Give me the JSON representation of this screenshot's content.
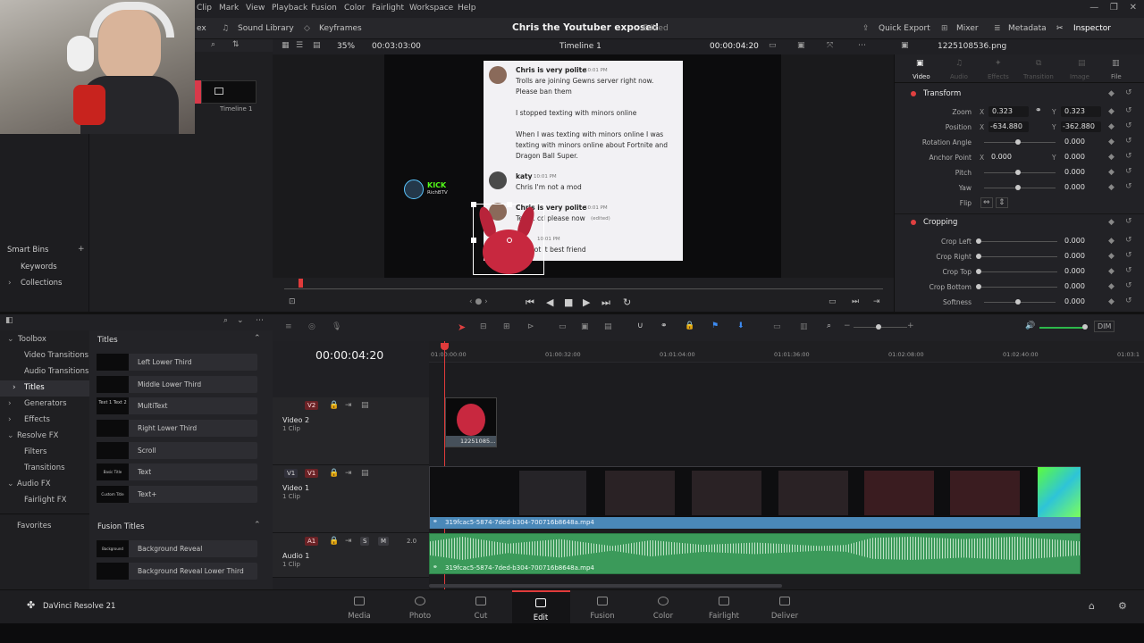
{
  "menubar": {
    "items": [
      "Clip",
      "Mark",
      "View",
      "Playback",
      "Fusion",
      "Color",
      "Fairlight",
      "Workspace",
      "Help"
    ]
  },
  "toolbar": {
    "index_partial": "ex",
    "sound_library": "Sound Library",
    "keyframes": "Keyframes",
    "project_title": "Chris the Youtuber exposed",
    "edited": "Edited",
    "quick_export": "Quick Export",
    "mixer": "Mixer",
    "metadata": "Metadata",
    "inspector": "Inspector"
  },
  "media": {
    "timeline_label": "Timeline 1",
    "smart_bins": "Smart Bins",
    "keywords": "Keywords",
    "collections": "Collections"
  },
  "viewer": {
    "zoom": "35%",
    "source_timecode": "00:03:03:00",
    "timeline_name": "Timeline 1",
    "record_timecode": "00:00:04:20",
    "clip_name": "1225108536.png"
  },
  "chat": {
    "msg1_name": "Chris is very polite",
    "msg1_time": "10:01 PM",
    "msg1_line1": "Trolls are joining Gewns server right now.",
    "msg1_line2": "Please ban them",
    "msg1_line3": "I stopped texting with minors online",
    "msg1_line4": "When I was texting with minors online I was",
    "msg1_line5": "texting with minors online about Fortnite and",
    "msg1_line6": "Dragon Ball Super.",
    "msg2_name": "katy",
    "msg2_time": "10:01 PM",
    "msg2_text": "Chris I'm not a mod",
    "msg3_name": "Chris is very polite",
    "msg3_time": "10:01 PM",
    "msg3_text": "Tell ... cd please now",
    "msg3_edited": "(edited)",
    "msg4_time": "10:01 PM",
    "msg4_text": "got it best friend",
    "kick_brand": "KICK",
    "kick_channel": "RichBTV"
  },
  "inspector": {
    "tabs": [
      "Video",
      "Audio",
      "Effects",
      "Transition",
      "Image",
      "File"
    ],
    "transform_title": "Transform",
    "zoom_label": "Zoom",
    "zoom_x": "0.323",
    "zoom_y": "0.323",
    "position_label": "Position",
    "position_x": "-634.880",
    "position_y": "-362.880",
    "rotation_label": "Rotation Angle",
    "rotation_val": "0.000",
    "anchor_label": "Anchor Point",
    "anchor_x": "0.000",
    "anchor_y": "0.000",
    "pitch_label": "Pitch",
    "pitch_val": "0.000",
    "yaw_label": "Yaw",
    "yaw_val": "0.000",
    "flip_label": "Flip",
    "cropping_title": "Cropping",
    "crop_left_label": "Crop Left",
    "crop_left": "0.000",
    "crop_right_label": "Crop Right",
    "crop_right": "0.000",
    "crop_top_label": "Crop Top",
    "crop_top": "0.000",
    "crop_bottom_label": "Crop Bottom",
    "crop_bottom": "0.000",
    "softness_label": "Softness",
    "softness": "0.000",
    "x": "X",
    "y": "Y"
  },
  "toolbox": {
    "items": [
      "Toolbox",
      "Video Transitions",
      "Audio Transitions",
      "Titles",
      "Generators",
      "Effects",
      "Resolve FX",
      "Filters",
      "Transitions",
      "Audio FX",
      "Fairlight FX",
      "Favorites"
    ]
  },
  "titles": {
    "header": "Titles",
    "items": [
      "Left Lower Third",
      "Middle Lower Third",
      "MultiText",
      "Right Lower Third",
      "Scroll",
      "Text",
      "Text+"
    ],
    "thumb_texts": [
      "",
      "",
      "Text 1 Text 2",
      "",
      "",
      "Basic Title",
      "Custom Title"
    ],
    "fusion_header": "Fusion Titles",
    "fusion_items": [
      "Background Reveal",
      "Background Reveal Lower Third"
    ],
    "fusion_thumbs": [
      "Background Reveal",
      ""
    ]
  },
  "timeline": {
    "timecode": "00:00:04:20",
    "ruler": [
      "01:00:00:00",
      "01:00:32:00",
      "01:01:04:00",
      "01:01:36:00",
      "01:02:08:00",
      "01:02:40:00",
      "01:03:1"
    ],
    "v2_tag": "V2",
    "v2_name": "Video 2",
    "v2_clips": "1 Clip",
    "v1_tag": "V1",
    "v1_src": "V1",
    "v1_name": "Video 1",
    "v1_clips": "1 Clip",
    "a1_tag": "A1",
    "a1_name": "Audio 1",
    "a1_clips": "1 Clip",
    "a1_s": "S",
    "a1_m": "M",
    "a1_level": "2.0",
    "png_clip": "12251085...",
    "video_clip": "319fcac5-5874-7ded-b304-700716b8648a.mp4",
    "audio_clip": "319fcac5-5874-7ded-b304-700716b8648a.mp4",
    "dim": "DIM"
  },
  "pagebar": {
    "app_name": "DaVinci Resolve 21",
    "pages": [
      "Media",
      "Photo",
      "Cut",
      "Edit",
      "Fusion",
      "Color",
      "Fairlight",
      "Deliver"
    ],
    "active": "Edit"
  },
  "colors": {
    "accent": "#d43a3a",
    "clip_blue": "#4a88b8",
    "audio_green": "#3b9a5a",
    "active_page": "#ffffff"
  }
}
